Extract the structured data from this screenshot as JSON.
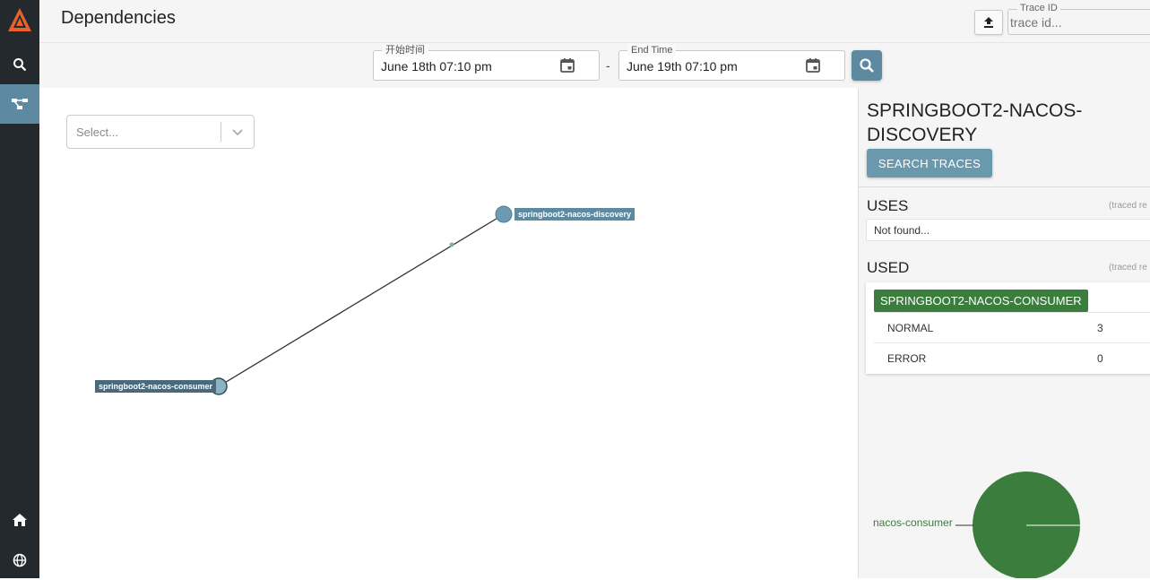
{
  "header": {
    "title": "Dependencies",
    "trace_id_label": "Trace ID",
    "trace_id_placeholder": "trace id..."
  },
  "sidebar": {
    "items": [
      {
        "icon": "search-icon",
        "active": false
      },
      {
        "icon": "dependencies-icon",
        "active": true
      },
      {
        "icon": "home-icon",
        "active": false
      },
      {
        "icon": "globe-icon",
        "active": false
      }
    ]
  },
  "toolbar": {
    "start_label": "开始时间",
    "start_value": "June 18th 07:10 pm",
    "end_label": "End Time",
    "end_value": "June 19th 07:10 pm",
    "separator": "-"
  },
  "graph": {
    "select_placeholder": "Select...",
    "nodes": [
      {
        "name": "springboot2-nacos-discovery"
      },
      {
        "name": "springboot2-nacos-consumer"
      }
    ]
  },
  "panel": {
    "title": "SPRINGBOOT2-NACOS-DISCOVERY",
    "search_button": "SEARCH TRACES",
    "uses_title": "USES",
    "uses_note": "(traced re",
    "uses_empty": "Not found...",
    "used_title": "USED",
    "used_note": "(traced re",
    "used_service": "SPRINGBOOT2-NACOS-CONSUMER",
    "used_rows": [
      {
        "label": "NORMAL",
        "value": "3"
      },
      {
        "label": "ERROR",
        "value": "0"
      }
    ],
    "pie_label": "nacos-consumer"
  },
  "colors": {
    "sidebar": "#24292d",
    "accent": "#5d8aa0",
    "service_green": "#3a7d3d",
    "logo": "#e8632b"
  }
}
